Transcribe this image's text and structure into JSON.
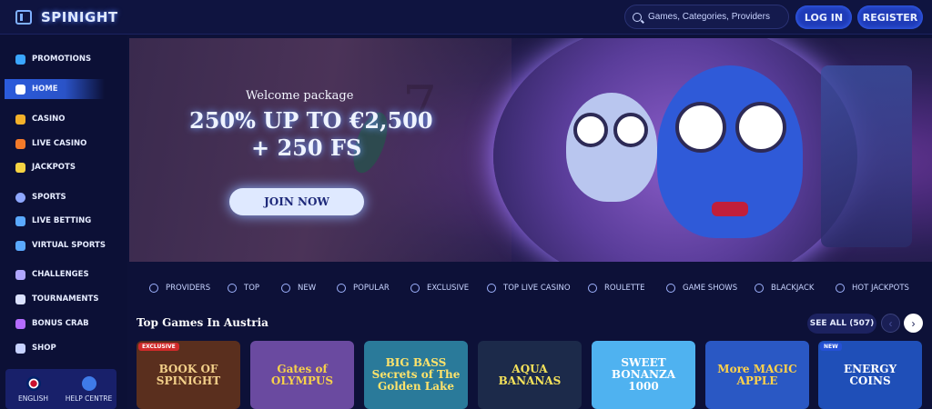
{
  "header": {
    "logo": "SPINIGHT",
    "search_placeholder": "Games, Categories, Providers",
    "login_label": "LOG IN",
    "register_label": "REGISTER"
  },
  "sidebar": {
    "items": [
      {
        "label": "PROMOTIONS",
        "icon": "gift-icon",
        "color": "#3aa6ff"
      },
      {
        "label": "HOME",
        "icon": "home-icon",
        "color": "#ffffff",
        "active": true
      },
      {
        "label": "CASINO",
        "icon": "casino-icon",
        "color": "#f4b12a"
      },
      {
        "label": "LIVE CASINO",
        "icon": "live-casino-icon",
        "color": "#f37a2a"
      },
      {
        "label": "JACKPOTS",
        "icon": "jackpot-icon",
        "color": "#f6d343"
      },
      {
        "label": "SPORTS",
        "icon": "sports-icon",
        "color": "#8ea7ff"
      },
      {
        "label": "LIVE BETTING",
        "icon": "live-betting-icon",
        "color": "#5aa9ff"
      },
      {
        "label": "VIRTUAL SPORTS",
        "icon": "virtual-sports-icon",
        "color": "#5aa9ff"
      },
      {
        "label": "CHALLENGES",
        "icon": "challenges-icon",
        "color": "#b0a6ff"
      },
      {
        "label": "TOURNAMENTS",
        "icon": "trophy-icon",
        "color": "#dbe2ff"
      },
      {
        "label": "BONUS CRAB",
        "icon": "bonus-crab-icon",
        "color": "#b46cff"
      },
      {
        "label": "SHOP",
        "icon": "shop-icon",
        "color": "#c7d2ff"
      }
    ],
    "language_label": "ENGLISH",
    "help_label": "HELP CENTRE"
  },
  "banner": {
    "subtitle": "Welcome package",
    "line1": "250% UP TO €2,500",
    "line2": "+ 250 FS",
    "button_label": "JOIN NOW"
  },
  "categories": [
    {
      "label": "PROVIDERS"
    },
    {
      "label": "TOP"
    },
    {
      "label": "NEW"
    },
    {
      "label": "POPULAR"
    },
    {
      "label": "EXCLUSIVE"
    },
    {
      "label": "TOP LIVE CASINO"
    },
    {
      "label": "ROULETTE"
    },
    {
      "label": "GAME SHOWS"
    },
    {
      "label": "BLACKJACK"
    },
    {
      "label": "HOT JACKPOTS"
    }
  ],
  "top_games": {
    "title": "Top Games In Austria",
    "see_all": "SEE ALL (507)",
    "games": [
      {
        "title": "BOOK OF SPINIGHT",
        "badge": "EXCLUSIVE",
        "bg": "#5a2f1e",
        "fg": "#f3d08a"
      },
      {
        "title": "Gates of OLYMPUS",
        "badge": "",
        "bg": "#6a4aa0",
        "fg": "#f7d14a"
      },
      {
        "title": "BIG BASS Secrets of The Golden Lake",
        "badge": "",
        "bg": "#2a7a9a",
        "fg": "#ffe36b"
      },
      {
        "title": "AQUA BANANAS",
        "badge": "",
        "bg": "#1c2a4a",
        "fg": "#f5e25a"
      },
      {
        "title": "SWEET BONANZA 1000",
        "badge": "",
        "bg": "#4fb2f0",
        "fg": "#ffffff"
      },
      {
        "title": "More MAGIC APPLE",
        "badge": "",
        "bg": "#2a58c4",
        "fg": "#ffd24a"
      },
      {
        "title": "ENERGY COINS",
        "badge": "NEW",
        "bg": "#1f4fb8",
        "fg": "#ffffff"
      }
    ]
  }
}
